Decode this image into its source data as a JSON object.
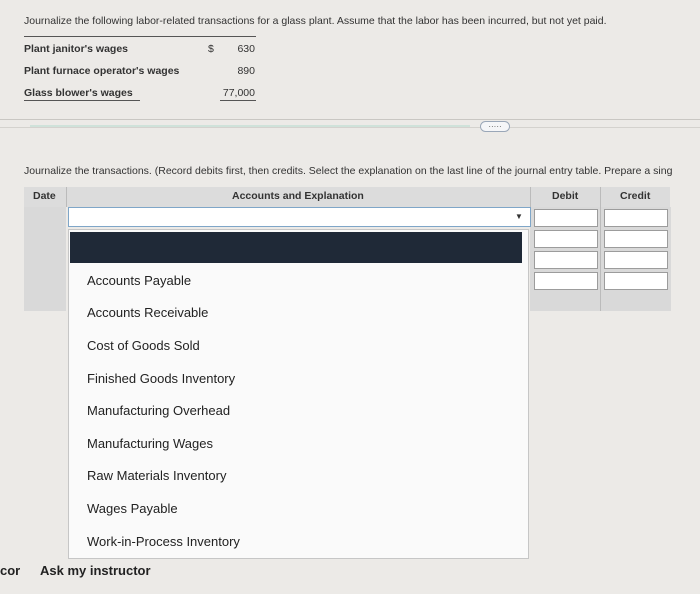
{
  "prompt": "Journalize the following labor-related transactions for a glass plant. Assume that the labor has been incurred, but not yet paid.",
  "labor_items": [
    {
      "label": "Plant janitor's wages",
      "currency": "$",
      "amount": "630"
    },
    {
      "label": "Plant furnace operator's wages",
      "amount": "890"
    },
    {
      "label": "Glass blower's wages",
      "amount": "77,000"
    }
  ],
  "expand_label": "·····",
  "instructions": "Journalize the transactions. (Record debits first, then credits. Select the explanation on the last line of the journal entry table. Prepare a sing",
  "table": {
    "headers": {
      "date": "Date",
      "accounts": "Accounts and Explanation",
      "debit": "Debit",
      "credit": "Credit"
    },
    "caret": "▼"
  },
  "dropdown_options": [
    "Accounts Payable",
    "Accounts Receivable",
    "Cost of Goods Sold",
    "Finished Goods Inventory",
    "Manufacturing Overhead",
    "Manufacturing Wages",
    "Raw Materials Inventory",
    "Wages Payable",
    "Work-in-Process Inventory"
  ],
  "footer": {
    "partial_left": "cor",
    "ask_instructor": "Ask my instructor"
  }
}
